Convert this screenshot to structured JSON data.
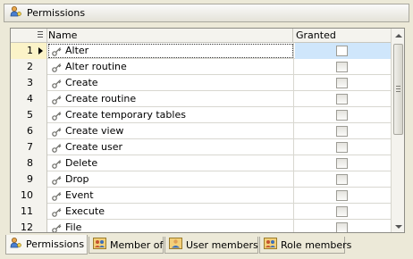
{
  "panel": {
    "title": "Permissions",
    "title_icon": "users-key-icon"
  },
  "grid": {
    "columns": {
      "name": "Name",
      "granted": "Granted"
    },
    "selected_index": 0,
    "rows": [
      {
        "num": "1",
        "name": "Alter",
        "granted": false
      },
      {
        "num": "2",
        "name": "Alter routine",
        "granted": false
      },
      {
        "num": "3",
        "name": "Create",
        "granted": false
      },
      {
        "num": "4",
        "name": "Create routine",
        "granted": false
      },
      {
        "num": "5",
        "name": "Create temporary tables",
        "granted": false
      },
      {
        "num": "6",
        "name": "Create view",
        "granted": false
      },
      {
        "num": "7",
        "name": "Create user",
        "granted": false
      },
      {
        "num": "8",
        "name": "Delete",
        "granted": false
      },
      {
        "num": "9",
        "name": "Drop",
        "granted": false
      },
      {
        "num": "10",
        "name": "Event",
        "granted": false
      },
      {
        "num": "11",
        "name": "Execute",
        "granted": false
      },
      {
        "num": "12",
        "name": "File",
        "granted": false
      }
    ]
  },
  "tabs": [
    {
      "label": "Permissions",
      "icon": "users-key-icon",
      "active": true
    },
    {
      "label": "Member of",
      "icon": "group-icon",
      "active": false
    },
    {
      "label": "User members",
      "icon": "user-icon",
      "active": false
    },
    {
      "label": "Role members",
      "icon": "group-icon",
      "active": false
    }
  ]
}
